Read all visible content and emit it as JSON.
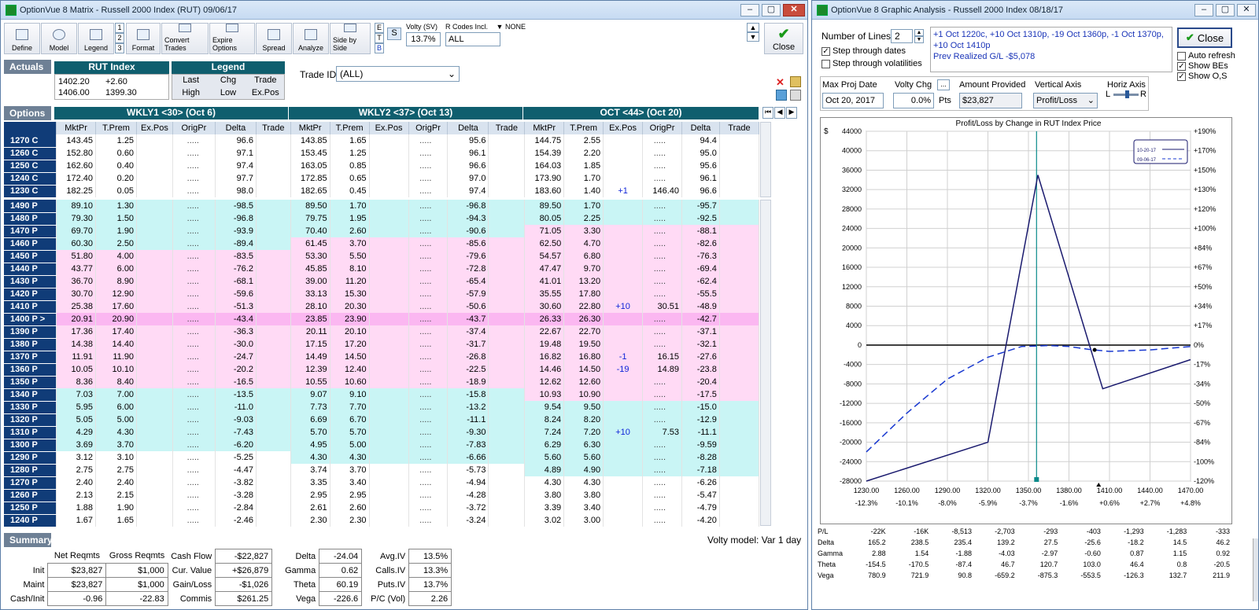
{
  "win1": {
    "title": "OptionVue 8 Matrix - Russell 2000 Index (RUT)  09/06/17"
  },
  "toolbar": {
    "define": "Define",
    "model": "Model",
    "legend": "Legend",
    "format": "Format",
    "convert": "Convert Trades",
    "expire": "Expire Options",
    "spread": "Spread",
    "analyze": "Analyze",
    "side": "Side by Side",
    "close": "Close",
    "nums": [
      "1",
      "2",
      "3"
    ],
    "etb": [
      "E",
      "T",
      "B"
    ],
    "s": "S",
    "volty_label": "Volty (SV)",
    "volty_value": "13.7%",
    "rcodes_label": "R Codes Incl.",
    "rcodes_none": "NONE",
    "rcodes_value": "ALL"
  },
  "actuals": {
    "label": "Actuals",
    "rut_title": "RUT Index",
    "r1a": "1402.20",
    "r1b": "+2.60",
    "r2a": "1406.00",
    "r2b": "1399.30",
    "legend_title": "Legend",
    "lg": [
      "Last",
      "Chg",
      "Trade",
      "High",
      "Low",
      "Ex.Pos"
    ],
    "trade_id_label": "Trade ID",
    "trade_id_value": "(ALL)"
  },
  "options": {
    "label": "Options",
    "series": [
      "WKLY1 <30> (Oct 6)",
      "WKLY2 <37> (Oct 13)",
      "OCT <44> (Oct 20)"
    ],
    "cols1": [
      "MktPr",
      "T.Prem",
      "Ex.Pos",
      "OrigPr",
      "Delta",
      "Trade"
    ],
    "cols3": [
      "MktPr",
      "T.Prem",
      "Ex.Pos",
      "OrigPr",
      "Delta",
      "Trade"
    ]
  },
  "calls": [
    [
      "1270 C",
      "143.45",
      "1.25",
      ".....",
      "96.6",
      "",
      "143.85",
      "1.65",
      ".....",
      "95.6",
      "",
      "144.75",
      "2.55",
      "",
      ".....",
      "94.4",
      ""
    ],
    [
      "1260 C",
      "152.80",
      "0.60",
      ".....",
      "97.1",
      "",
      "153.45",
      "1.25",
      ".....",
      "96.1",
      "",
      "154.39",
      "2.20",
      "",
      ".....",
      "95.0",
      ""
    ],
    [
      "1250 C",
      "162.60",
      "0.40",
      ".....",
      "97.4",
      "",
      "163.05",
      "0.85",
      ".....",
      "96.6",
      "",
      "164.03",
      "1.85",
      "",
      ".....",
      "95.6",
      ""
    ],
    [
      "1240 C",
      "172.40",
      "0.20",
      ".....",
      "97.7",
      "",
      "172.85",
      "0.65",
      ".....",
      "97.0",
      "",
      "173.90",
      "1.70",
      "",
      ".....",
      "96.1",
      ""
    ],
    [
      "1230 C",
      "182.25",
      "0.05",
      ".....",
      "98.0",
      "",
      "182.65",
      "0.45",
      ".....",
      "97.4",
      "",
      "183.60",
      "1.40",
      "+1",
      "146.40",
      "96.6",
      ""
    ]
  ],
  "puts": [
    [
      "1490 P",
      "89.10",
      "1.30",
      ".....",
      "-98.5",
      "c",
      "89.50",
      "1.70",
      ".....",
      "-96.8",
      "c",
      "89.50",
      "1.70",
      "",
      ".....",
      "-95.7",
      "c"
    ],
    [
      "1480 P",
      "79.30",
      "1.50",
      ".....",
      "-96.8",
      "c",
      "79.75",
      "1.95",
      ".....",
      "-94.3",
      "c",
      "80.05",
      "2.25",
      "",
      ".....",
      "-92.5",
      "c"
    ],
    [
      "1470 P",
      "69.70",
      "1.90",
      ".....",
      "-93.9",
      "c",
      "70.40",
      "2.60",
      ".....",
      "-90.6",
      "c",
      "71.05",
      "3.30",
      "",
      ".....",
      "-88.1",
      "p"
    ],
    [
      "1460 P",
      "60.30",
      "2.50",
      ".....",
      "-89.4",
      "c",
      "61.45",
      "3.70",
      ".....",
      "-85.6",
      "p",
      "62.50",
      "4.70",
      "",
      ".....",
      "-82.6",
      "p"
    ],
    [
      "1450 P",
      "51.80",
      "4.00",
      ".....",
      "-83.5",
      "p",
      "53.30",
      "5.50",
      ".....",
      "-79.6",
      "p",
      "54.57",
      "6.80",
      "",
      ".....",
      "-76.3",
      "p"
    ],
    [
      "1440 P",
      "43.77",
      "6.00",
      ".....",
      "-76.2",
      "p",
      "45.85",
      "8.10",
      ".....",
      "-72.8",
      "p",
      "47.47",
      "9.70",
      "",
      ".....",
      "-69.4",
      "p"
    ],
    [
      "1430 P",
      "36.70",
      "8.90",
      ".....",
      "-68.1",
      "p",
      "39.00",
      "11.20",
      ".....",
      "-65.4",
      "p",
      "41.01",
      "13.20",
      "",
      ".....",
      "-62.4",
      "p"
    ],
    [
      "1420 P",
      "30.70",
      "12.90",
      ".....",
      "-59.6",
      "p",
      "33.13",
      "15.30",
      ".....",
      "-57.9",
      "p",
      "35.55",
      "17.80",
      "",
      ".....",
      "-55.5",
      "p"
    ],
    [
      "1410 P",
      "25.38",
      "17.60",
      ".....",
      "-51.3",
      "p",
      "28.10",
      "20.30",
      ".....",
      "-50.6",
      "p",
      "30.60",
      "22.80",
      "+10",
      "30.51",
      "-48.9",
      "p"
    ],
    [
      "1400 P >",
      "20.91",
      "20.90",
      ".....",
      "-43.4",
      "m",
      "23.85",
      "23.90",
      ".....",
      "-43.7",
      "m",
      "26.33",
      "26.30",
      "",
      ".....",
      "-42.7",
      "m"
    ],
    [
      "1390 P",
      "17.36",
      "17.40",
      ".....",
      "-36.3",
      "p",
      "20.11",
      "20.10",
      ".....",
      "-37.4",
      "p",
      "22.67",
      "22.70",
      "",
      ".....",
      "-37.1",
      "p"
    ],
    [
      "1380 P",
      "14.38",
      "14.40",
      ".....",
      "-30.0",
      "p",
      "17.15",
      "17.20",
      ".....",
      "-31.7",
      "p",
      "19.48",
      "19.50",
      "",
      ".....",
      "-32.1",
      "p"
    ],
    [
      "1370 P",
      "11.91",
      "11.90",
      ".....",
      "-24.7",
      "p",
      "14.49",
      "14.50",
      ".....",
      "-26.8",
      "p",
      "16.82",
      "16.80",
      "-1",
      "16.15",
      "-27.6",
      "p"
    ],
    [
      "1360 P",
      "10.05",
      "10.10",
      ".....",
      "-20.2",
      "p",
      "12.39",
      "12.40",
      ".....",
      "-22.5",
      "p",
      "14.46",
      "14.50",
      "-19",
      "14.89",
      "-23.8",
      "p"
    ],
    [
      "1350 P",
      "8.36",
      "8.40",
      ".....",
      "-16.5",
      "p",
      "10.55",
      "10.60",
      ".....",
      "-18.9",
      "p",
      "12.62",
      "12.60",
      "",
      ".....",
      "-20.4",
      "p"
    ],
    [
      "1340 P",
      "7.03",
      "7.00",
      ".....",
      "-13.5",
      "c",
      "9.07",
      "9.10",
      ".....",
      "-15.8",
      "c",
      "10.93",
      "10.90",
      "",
      ".....",
      "-17.5",
      "p"
    ],
    [
      "1330 P",
      "5.95",
      "6.00",
      ".....",
      "-11.0",
      "c",
      "7.73",
      "7.70",
      ".....",
      "-13.2",
      "c",
      "9.54",
      "9.50",
      "",
      ".....",
      "-15.0",
      "c"
    ],
    [
      "1320 P",
      "5.05",
      "5.00",
      ".....",
      "-9.03",
      "c",
      "6.69",
      "6.70",
      ".....",
      "-11.1",
      "c",
      "8.24",
      "8.20",
      "",
      ".....",
      "-12.9",
      "c"
    ],
    [
      "1310 P",
      "4.29",
      "4.30",
      ".....",
      "-7.43",
      "c",
      "5.70",
      "5.70",
      ".....",
      "-9.30",
      "c",
      "7.24",
      "7.20",
      "+10",
      "7.53",
      "-11.1",
      "c"
    ],
    [
      "1300 P",
      "3.69",
      "3.70",
      ".....",
      "-6.20",
      "c",
      "4.95",
      "5.00",
      ".....",
      "-7.83",
      "c",
      "6.29",
      "6.30",
      "",
      ".....",
      "-9.59",
      "c"
    ],
    [
      "1290 P",
      "3.12",
      "3.10",
      ".....",
      "-5.25",
      "w",
      "4.30",
      "4.30",
      ".....",
      "-6.66",
      "c",
      "5.60",
      "5.60",
      "",
      ".....",
      "-8.28",
      "c"
    ],
    [
      "1280 P",
      "2.75",
      "2.75",
      ".....",
      "-4.47",
      "w",
      "3.74",
      "3.70",
      ".....",
      "-5.73",
      "w",
      "4.89",
      "4.90",
      "",
      ".....",
      "-7.18",
      "c"
    ],
    [
      "1270 P",
      "2.40",
      "2.40",
      ".....",
      "-3.82",
      "w",
      "3.35",
      "3.40",
      ".....",
      "-4.94",
      "w",
      "4.30",
      "4.30",
      "",
      ".....",
      "-6.26",
      "w"
    ],
    [
      "1260 P",
      "2.13",
      "2.15",
      ".....",
      "-3.28",
      "w",
      "2.95",
      "2.95",
      ".....",
      "-4.28",
      "w",
      "3.80",
      "3.80",
      "",
      ".....",
      "-5.47",
      "w"
    ],
    [
      "1250 P",
      "1.88",
      "1.90",
      ".....",
      "-2.84",
      "w",
      "2.61",
      "2.60",
      ".....",
      "-3.72",
      "w",
      "3.39",
      "3.40",
      "",
      ".....",
      "-4.79",
      "w"
    ],
    [
      "1240 P",
      "1.67",
      "1.65",
      ".....",
      "-2.46",
      "w",
      "2.30",
      "2.30",
      ".....",
      "-3.24",
      "w",
      "3.02",
      "3.00",
      "",
      ".....",
      "-4.20",
      "w"
    ]
  ],
  "summary": {
    "label": "Summary",
    "volty_model": "Volty model: Var 1 day",
    "net_reqmts": "Net Reqmts",
    "gross_reqmts": "Gross Reqmts",
    "init_label": "Init",
    "init_net": "$23,827",
    "init_gross": "$1,000",
    "maint_label": "Maint",
    "maint_net": "$23,827",
    "maint_gross": "$1,000",
    "cashinit_label": "Cash/Init",
    "cashinit_net": "-0.96",
    "cashinit_gross": "-22.83",
    "cashflow_label": "Cash Flow",
    "cashflow": "-$22,827",
    "curvalue_label": "Cur. Value",
    "curvalue": "+$26,879",
    "gainloss_label": "Gain/Loss",
    "gainloss": "-$1,026",
    "commis_label": "Commis",
    "commis": "$261.25",
    "delta_label": "Delta",
    "delta": "-24.04",
    "gamma_label": "Gamma",
    "gamma": "0.62",
    "theta_label": "Theta",
    "theta": "60.19",
    "vega_label": "Vega",
    "vega": "-226.6",
    "aviv_label": "Avg.IV",
    "aviv": "13.5%",
    "callsiv_label": "Calls.IV",
    "callsiv": "13.3%",
    "putsiv_label": "Puts.IV",
    "putsiv": "13.7%",
    "pc_label": "P/C (Vol)",
    "pc": "2.26"
  },
  "win2": {
    "title": "OptionVue 8 Graphic Analysis - Russell 2000 Index  08/18/17",
    "num_lines_label": "Number of Lines",
    "num_lines": "2",
    "step_dates": "Step through dates",
    "step_vols": "Step through volatilities",
    "trades_text": [
      "+1 Oct 1220c, +10 Oct 1310p, -19 Oct 1360p, -1 Oct 1370p,",
      "+10 Oct 1410p",
      "Prev Realized G/L -$5,078"
    ],
    "close": "Close",
    "auto_refresh": "Auto refresh",
    "show_bes": "Show BEs",
    "show_os": "Show O,S",
    "max_proj_label": "Max Proj Date",
    "max_proj": "Oct 20, 2017",
    "volty_chg_label": "Volty Chg",
    "volty_chg": "0.0%",
    "pts": "Pts",
    "amount_label": "Amount Provided",
    "amount": "$23,827",
    "vaxis_label": "Vertical Axis",
    "vaxis": "Profit/Loss",
    "haxis_label": "Horiz Axis",
    "haxis_l": "L",
    "haxis_r": "R"
  },
  "chart_data": {
    "type": "line",
    "title": "Profit/Loss by Change in RUT Index Price",
    "y_unit_label": "$",
    "x_ticks": [
      "1230.00",
      "1260.00",
      "1290.00",
      "1320.00",
      "1350.00",
      "1380.00",
      "1410.00",
      "1440.00",
      "1470.00"
    ],
    "x_pct": [
      "-12.3%",
      "-10.1%",
      "-8.0%",
      "-5.9%",
      "-3.7%",
      "-1.6%",
      "+0.6%",
      "+2.7%",
      "+4.8%"
    ],
    "y_ticks": [
      "44000",
      "40000",
      "36000",
      "32000",
      "28000",
      "24000",
      "20000",
      "16000",
      "12000",
      "8000",
      "4000",
      "0",
      "-4000",
      "-8000",
      "-12000",
      "-16000",
      "-20000",
      "-24000",
      "-28000"
    ],
    "y_right": [
      "+190%",
      "+170%",
      "+150%",
      "+130%",
      "+120%",
      "+100%",
      "+84%",
      "+67%",
      "+50%",
      "+34%",
      "+17%",
      "0%",
      "-17%",
      "-34%",
      "-50%",
      "-67%",
      "-84%",
      "-100%",
      "-120%"
    ],
    "xlim": [
      1230,
      1470
    ],
    "ylim": [
      -28000,
      44000
    ],
    "current_price": 1356,
    "series": [
      {
        "name": "10-20-17",
        "style": "solid",
        "color": "#1a1a6e",
        "x": [
          1230,
          1320,
          1357,
          1405,
          1470
        ],
        "y": [
          -28000,
          -20000,
          35000,
          -9000,
          -3000
        ]
      },
      {
        "name": "09-06-17",
        "style": "dashed",
        "color": "#1838d0",
        "x": [
          1230,
          1260,
          1290,
          1320,
          1345,
          1365,
          1380,
          1395,
          1410,
          1440,
          1470
        ],
        "y": [
          -22000,
          -14000,
          -7000,
          -2500,
          -300,
          -100,
          -300,
          -900,
          -1300,
          -1000,
          -300
        ]
      }
    ]
  },
  "stats": {
    "labels": [
      "P/L",
      "Delta",
      "Gamma",
      "Theta",
      "Vega"
    ],
    "rows": [
      [
        "-22K",
        "-16K",
        "-8,513",
        "-2,703",
        "-293",
        "-403",
        "-1,293",
        "-1,283",
        "-333"
      ],
      [
        "165.2",
        "238.5",
        "235.4",
        "139.2",
        "27.5",
        "-25.6",
        "-18.2",
        "14.5",
        "46.2"
      ],
      [
        "2.88",
        "1.54",
        "-1.88",
        "-4.03",
        "-2.97",
        "-0.60",
        "0.87",
        "1.15",
        "0.92"
      ],
      [
        "-154.5",
        "-170.5",
        "-87.4",
        "46.7",
        "120.7",
        "103.0",
        "46.4",
        "0.8",
        "-20.5"
      ],
      [
        "780.9",
        "721.9",
        "90.8",
        "-659.2",
        "-875.3",
        "-553.5",
        "-126.3",
        "132.7",
        "211.9"
      ]
    ]
  }
}
